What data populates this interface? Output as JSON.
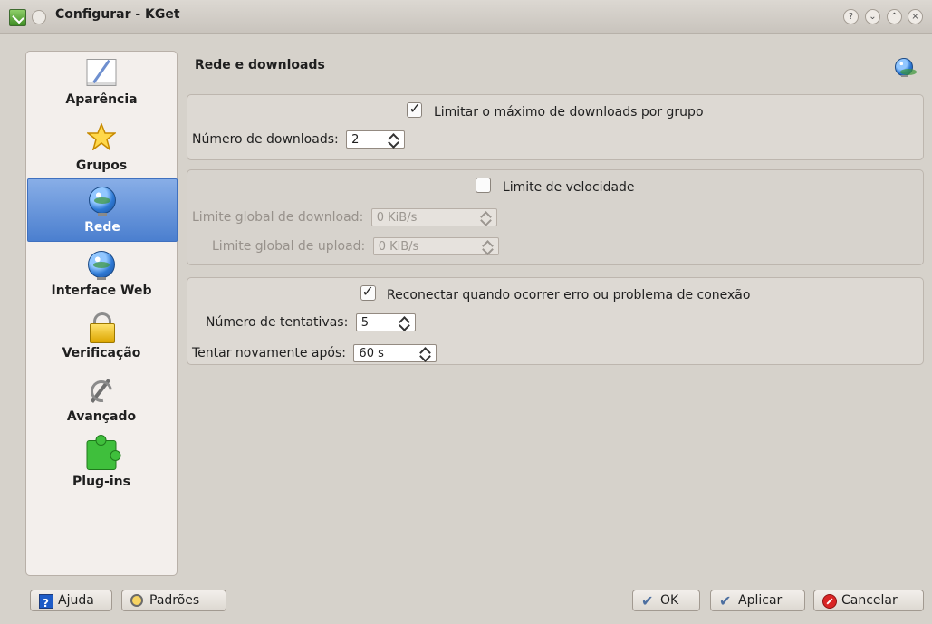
{
  "window": {
    "title": "Configurar - KGet",
    "buttons": [
      "?",
      "⌄",
      "⌃",
      "×"
    ]
  },
  "sidebar": {
    "items": [
      {
        "label": "Aparência",
        "icon": "appearance-icon"
      },
      {
        "label": "Grupos",
        "icon": "star-icon"
      },
      {
        "label": "Rede",
        "icon": "globe-icon",
        "selected": true
      },
      {
        "label": "Interface Web",
        "icon": "globe-icon"
      },
      {
        "label": "Verificação",
        "icon": "lock-icon"
      },
      {
        "label": "Avançado",
        "icon": "tools-icon"
      },
      {
        "label": "Plug-ins",
        "icon": "puzzle-icon"
      }
    ]
  },
  "main": {
    "title": "Rede e downloads",
    "groups": [
      {
        "checkbox_label": "Limitar o máximo de downloads por grupo",
        "checked": true,
        "fields": [
          {
            "label": "Número de downloads:",
            "value": "2"
          }
        ]
      },
      {
        "checkbox_label": "Limite de velocidade",
        "checked": false,
        "fields": [
          {
            "label": "Limite global de download:",
            "value": "0 KiB/s"
          },
          {
            "label": "Limite global de upload:",
            "value": "0 KiB/s"
          }
        ]
      },
      {
        "checkbox_label": "Reconectar quando ocorrer erro ou problema de conexão",
        "checked": true,
        "fields": [
          {
            "label": "Número de tentativas:",
            "value": "5"
          },
          {
            "label": "Tentar novamente após:",
            "value": "60 s"
          }
        ]
      }
    ]
  },
  "footer": {
    "help": "Ajuda",
    "defaults": "Padrões",
    "ok": "OK",
    "apply": "Aplicar",
    "cancel": "Cancelar"
  },
  "colors": {
    "window_bg": "#d6d2cb",
    "selected_bg": "#5d8fd8",
    "sidebar_bg": "#f3efec"
  }
}
